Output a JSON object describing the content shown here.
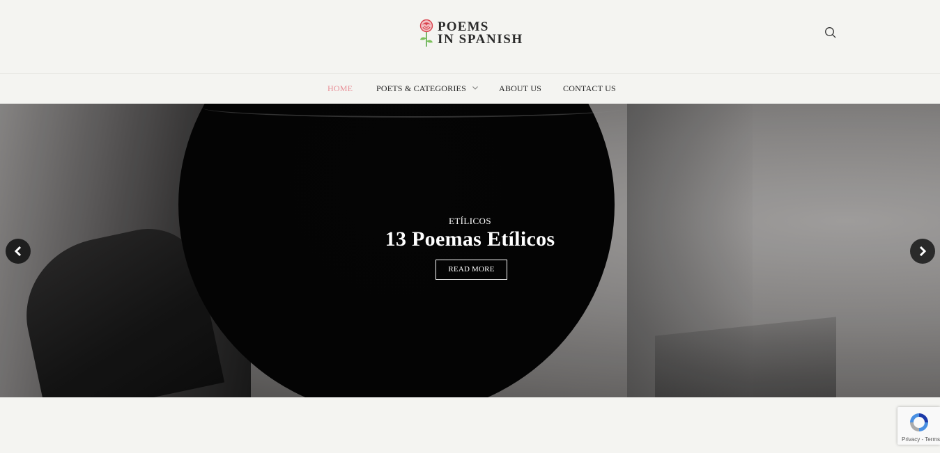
{
  "site": {
    "logo_line1": "POEMS",
    "logo_line2": "IN SPANISH"
  },
  "header": {
    "search_icon": "search-icon"
  },
  "nav": {
    "items": [
      {
        "label": "HOME",
        "active": true
      },
      {
        "label": "POETS & CATEGORIES",
        "has_dropdown": true
      },
      {
        "label": "ABOUT US"
      },
      {
        "label": "CONTACT US"
      }
    ]
  },
  "slider": {
    "category": "ETÍLICOS",
    "title": "13 Poemas Etílicos",
    "button_label": "READ MORE",
    "prev_icon": "chevron-left-icon",
    "next_icon": "chevron-right-icon"
  },
  "recaptcha": {
    "privacy_label": "Privacy",
    "separator": "-",
    "terms_label": "Terms"
  },
  "colors": {
    "accent": "#e88d95",
    "background": "#f4f4f1",
    "text": "#222222"
  }
}
